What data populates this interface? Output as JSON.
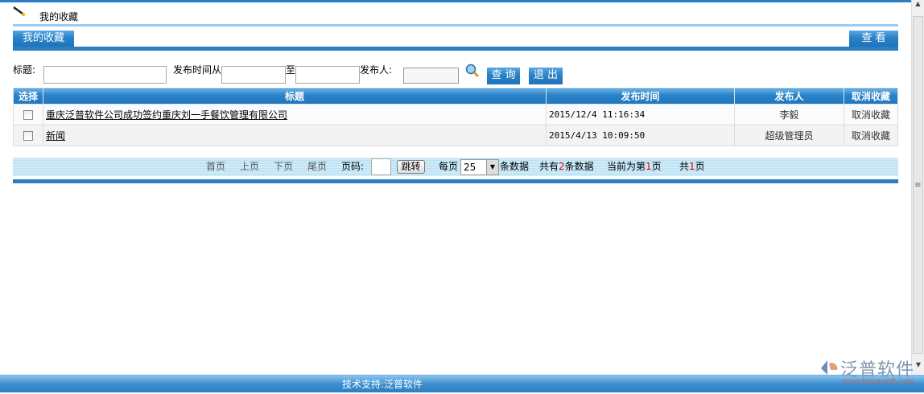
{
  "header": {
    "title": "我的收藏",
    "icon": "pen-icon"
  },
  "tabs": {
    "active": "我的收藏",
    "view_button": "查 看"
  },
  "search": {
    "title_label": "标题:",
    "title_value": "",
    "time_from_label": "发布时间从",
    "time_from_value": "",
    "to_label": "至",
    "time_to_value": "",
    "publisher_label": "发布人:",
    "publisher_value": "",
    "query_button": "查 询",
    "exit_button": "退 出"
  },
  "table": {
    "headers": [
      "选择",
      "标题",
      "发布时间",
      "发布人",
      "取消收藏"
    ],
    "rows": [
      {
        "title": "重庆泛普软件公司成功签约重庆刘一手餐饮管理有限公司",
        "time": "2015/12/4 11:16:34",
        "publisher": "李毅",
        "action": "取消收藏"
      },
      {
        "title": "新闻",
        "time": "2015/4/13 10:09:50",
        "publisher": "超级管理员",
        "action": "取消收藏"
      }
    ]
  },
  "pager": {
    "first": "首页",
    "prev": "上页",
    "next": "下页",
    "last": "尾页",
    "page_label": "页码:",
    "page_value": "",
    "jump": "跳转",
    "per_page_label": "每页",
    "per_page": "25",
    "per_page_suffix": "条数据",
    "total_prefix": "共有",
    "total": "2",
    "total_suffix": "条数据",
    "current_prefix": "当前为第",
    "current": "1",
    "current_suffix": "页",
    "pages_prefix": "共",
    "pages": "1",
    "pages_suffix": "页"
  },
  "footer": {
    "text": "技术支持:泛普软件",
    "logo_text": "泛普软件",
    "logo_url": "www.fanpusoft.com"
  },
  "colors": {
    "accent": "#2a82c8",
    "red": "#e00000"
  }
}
